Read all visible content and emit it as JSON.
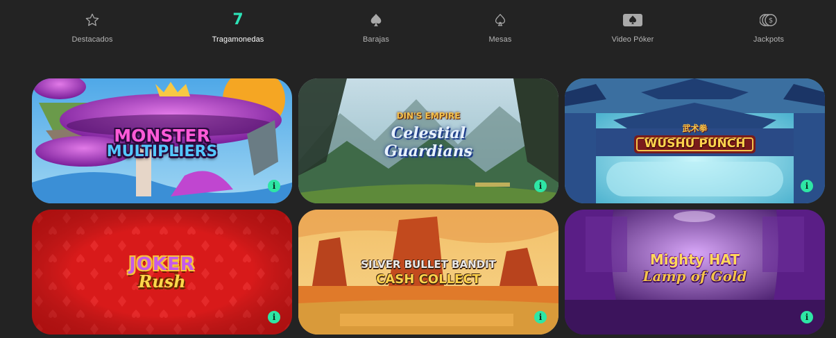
{
  "nav": {
    "items": [
      {
        "label": "Destacados",
        "icon": "star-icon"
      },
      {
        "label": "Tragamonedas",
        "icon": "seven-icon",
        "glyph": "7",
        "active": true
      },
      {
        "label": "Barajas",
        "icon": "spade-icon"
      },
      {
        "label": "Mesas",
        "icon": "spade-outline-icon"
      },
      {
        "label": "Video Póker",
        "icon": "card-spade-icon"
      },
      {
        "label": "Jackpots",
        "icon": "coins-icon"
      }
    ],
    "accent_color": "#2de3b7"
  },
  "games": [
    {
      "title_line1": "MONSTER",
      "title_line2": "MULTIPLIERS",
      "info": "i"
    },
    {
      "title_top": "DIN'S EMPIRE",
      "title_line1": "Celestial",
      "title_line2": "Guardians",
      "info": "i"
    },
    {
      "title_top": "武术拳",
      "title_line1": "WUSHU PUNCH",
      "info": "i"
    },
    {
      "title_line1": "JOKER",
      "title_line2": "Rush",
      "info": "i"
    },
    {
      "title_line1": "SILVER BULLET BANDIT",
      "title_line2": "CASH COLLECT",
      "info": "i"
    },
    {
      "title_line1": "Mighty HAT",
      "title_line2": "Lamp of Gold",
      "info": "i"
    }
  ],
  "info_badge_color": "#2ee6a5"
}
